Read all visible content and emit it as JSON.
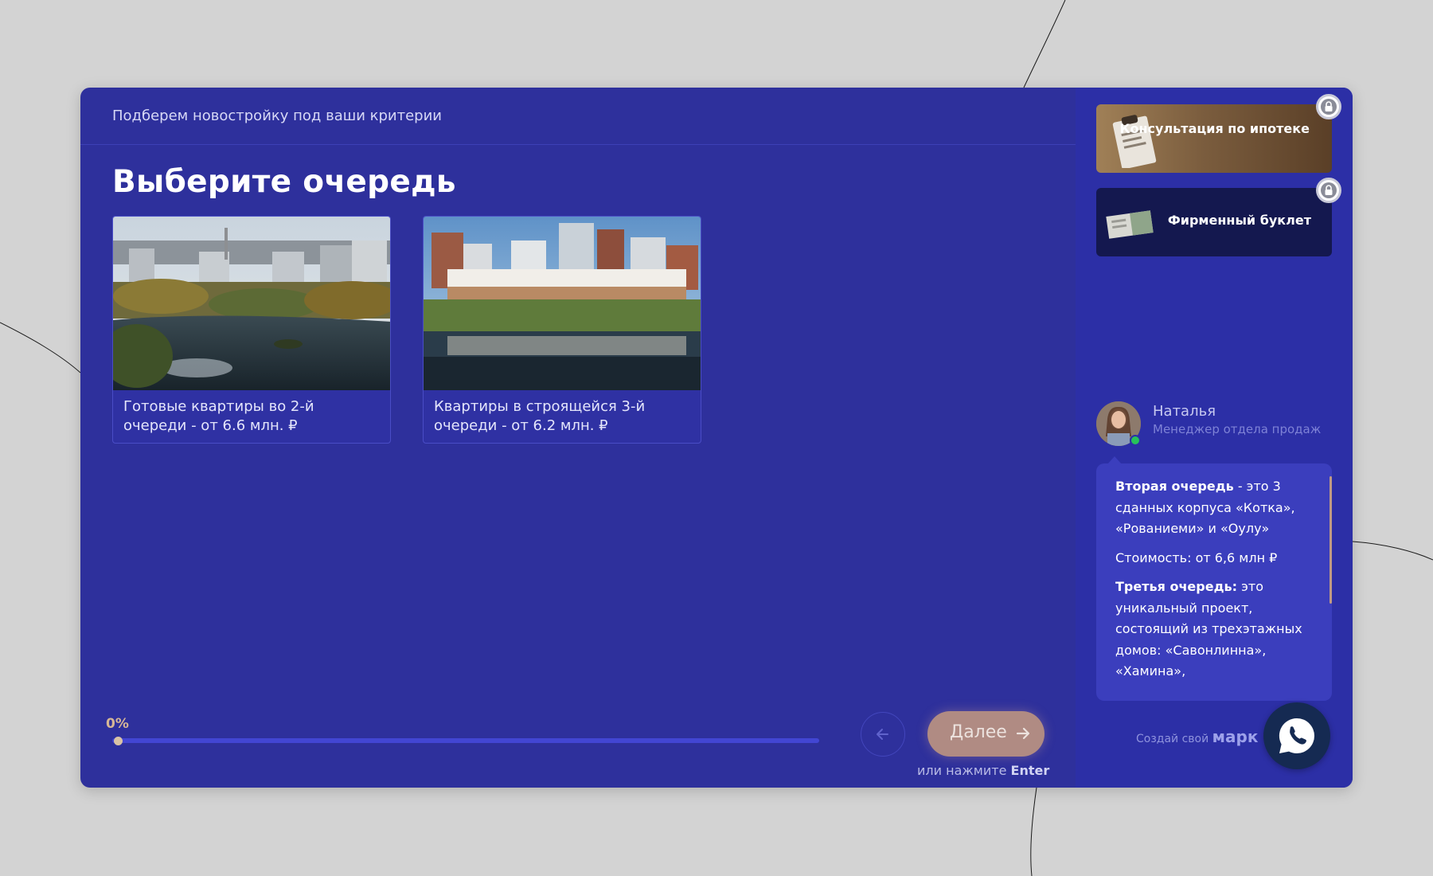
{
  "header": {
    "subtitle": "Подберем новостройку под ваши критерии"
  },
  "question": {
    "title": "Выберите очередь",
    "options": [
      {
        "label": "Готовые квартиры во 2-й очереди - от 6.6 млн. ₽"
      },
      {
        "label": "Квартиры в строящейся 3-й очереди - от 6.2 млн. ₽"
      }
    ]
  },
  "progress": {
    "label": "0%",
    "value": 0
  },
  "navigation": {
    "next_label": "Далее",
    "hint_prefix": "или нажмите",
    "hint_key": "Enter"
  },
  "bonuses": [
    {
      "title": "Консультация по ипотеке",
      "locked": true
    },
    {
      "title": "Фирменный буклет",
      "locked": true
    }
  ],
  "manager": {
    "name": "Наталья",
    "role": "Менеджер отдела продаж",
    "status": "online"
  },
  "message": {
    "p1_bold": "Вторая очередь",
    "p1_rest": " - это 3 сданных корпуса «Котка», «Рованиеми» и «Оулу»",
    "p2": "Стоимость: от 6,6 млн ₽",
    "p3_bold": "Третья очередь:",
    "p3_rest": " это уникальный проект, состоящий из трехэтажных домов: «Савонлинна», «Хамина»,"
  },
  "footer": {
    "brand_prefix": "Создай свой",
    "brand_name": "марк"
  },
  "colors": {
    "background": "#d3d3d3",
    "panel": "#2e309c",
    "accent": "#b08b83",
    "progress_accent": "#d6b796"
  }
}
